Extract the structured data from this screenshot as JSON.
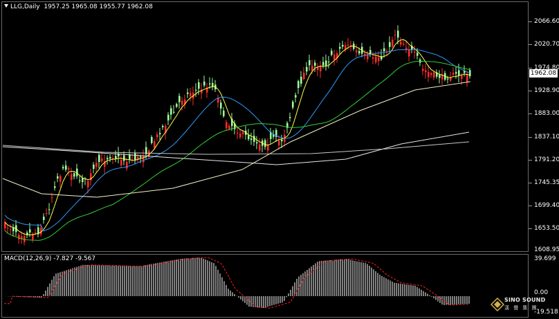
{
  "window": {
    "symbol_header": "LLG,Daily  1957.25 1965.08 1955.77 1962.08"
  },
  "price_axis": {
    "labels": [
      "2066.60",
      "2020.70",
      "1974.80",
      "1928.90",
      "1883.00",
      "1837.10",
      "1791.20",
      "1745.35",
      "1699.40",
      "1653.50",
      "1608.95"
    ],
    "current_price": "1962.08"
  },
  "macd": {
    "header": "MACD(12,26,9) -7.827 -9.567",
    "axis_labels": {
      "top": "39.699",
      "zero": "0.00",
      "bottom": "-19.518"
    }
  },
  "logo": {
    "brand": "SINO SOUND",
    "brand_cn": "漢 聲 集 團",
    "icon": "diamond-logo-icon"
  },
  "colors": {
    "background": "#000000",
    "bull_candle": "#ff2b2b",
    "bear_candle": "#9dff9d",
    "ma_fast": "#ffff4d",
    "ma_mid": "#2f9bff",
    "ma_slow": "#35d035",
    "ma_200": "#f5f0c8",
    "ma_long": "#e8e8e8",
    "macd_hist": "#ffffff",
    "macd_signal": "#ff2020"
  }
}
